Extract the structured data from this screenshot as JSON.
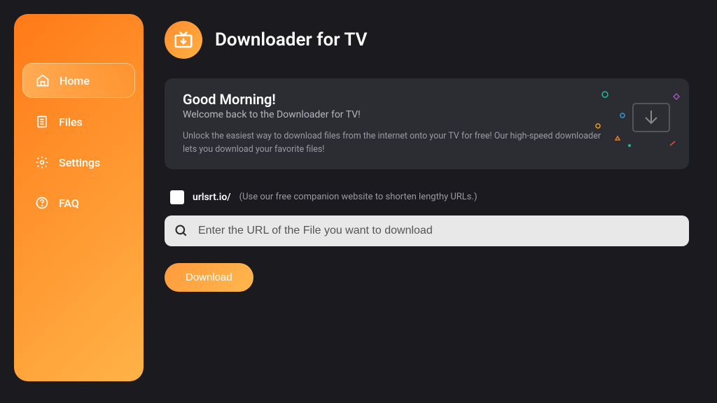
{
  "sidebar": {
    "items": [
      {
        "label": "Home"
      },
      {
        "label": "Files"
      },
      {
        "label": "Settings"
      },
      {
        "label": "FAQ"
      }
    ]
  },
  "header": {
    "title": "Downloader for TV"
  },
  "welcome": {
    "greeting": "Good Morning!",
    "subtitle": "Welcome back to the Downloader for TV!",
    "description": "Unlock the easiest way to download files from the internet onto your TV for free! Our high-speed downloader lets you download your favorite files!"
  },
  "shortener": {
    "label": "urlsrt.io/",
    "hint": "(Use our free companion website to shorten lengthy URLs.)"
  },
  "url_input": {
    "placeholder": "Enter the URL of the File you want to download"
  },
  "actions": {
    "download": "Download"
  }
}
